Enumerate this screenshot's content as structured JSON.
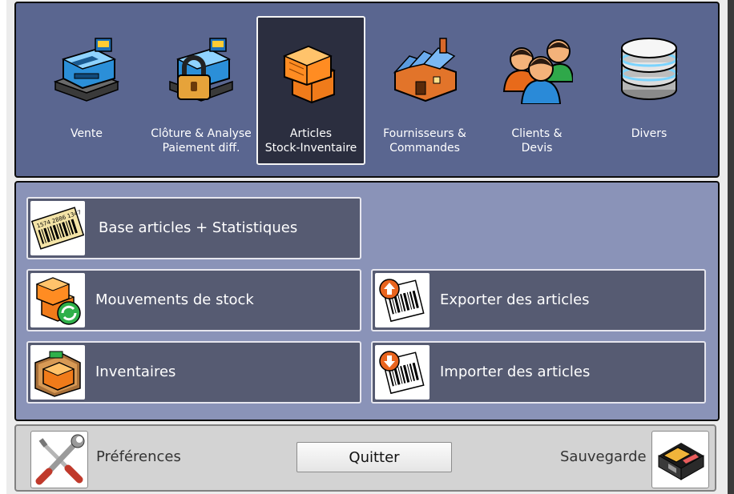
{
  "modules": [
    {
      "label": "Vente",
      "icon": "cash-register-icon"
    },
    {
      "label": "Clôture & Analyse\nPaiement diff.",
      "icon": "locked-register-icon"
    },
    {
      "label": "Articles\nStock-Inventaire",
      "icon": "boxes-icon",
      "active": true
    },
    {
      "label": "Fournisseurs &\nCommandes",
      "icon": "factory-icon"
    },
    {
      "label": "Clients &\nDevis",
      "icon": "users-icon"
    },
    {
      "label": "Divers",
      "icon": "database-icon"
    }
  ],
  "actions": {
    "base_articles": {
      "label": "Base articles + Statistiques",
      "icon": "barcode-icon",
      "barcode_text": "1574 2886 1347"
    },
    "mouvements": {
      "label": "Mouvements de stock",
      "icon": "box-refresh-icon"
    },
    "exporter": {
      "label": "Exporter des articles",
      "icon": "barcode-export-icon"
    },
    "inventaires": {
      "label": "Inventaires",
      "icon": "clipboard-box-icon"
    },
    "importer": {
      "label": "Importer des articles",
      "icon": "barcode-import-icon"
    }
  },
  "bottom": {
    "preferences_label": "Préférences",
    "quit_label": "Quitter",
    "sauvegarde_label": "Sauvegarde"
  },
  "colors": {
    "top_panel": "#5a6690",
    "mid_panel": "#8a93b8",
    "button": "#565b72",
    "active_module": "#2b2e3f"
  }
}
